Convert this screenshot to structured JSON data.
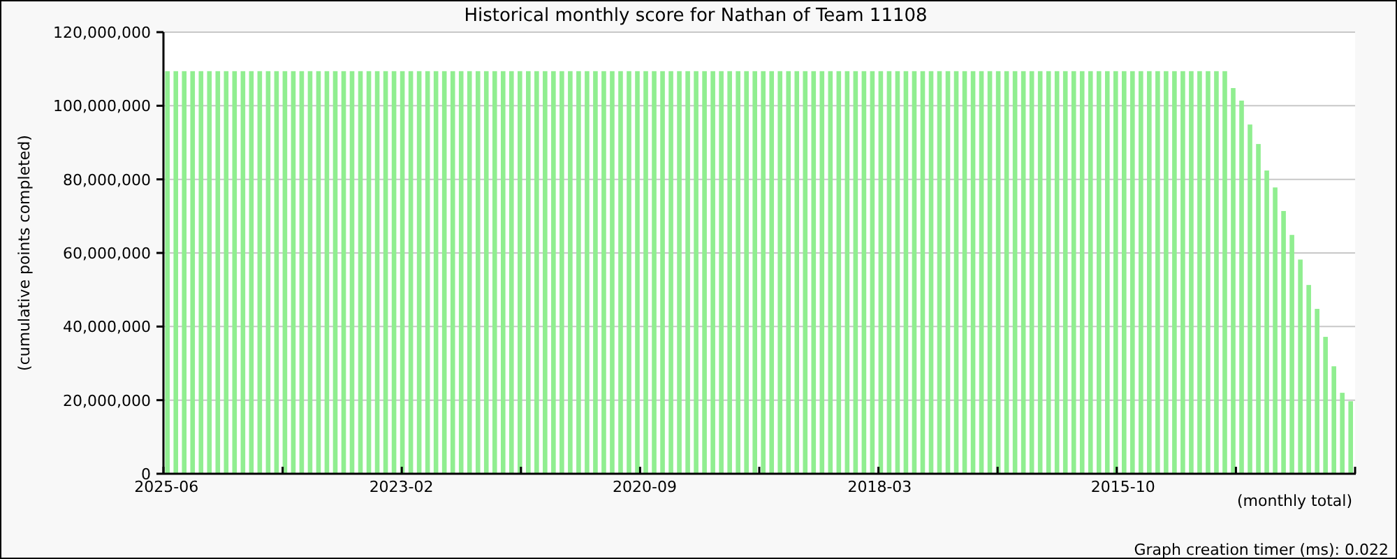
{
  "chart_data": {
    "type": "bar",
    "title": "Historical monthly score for Nathan of Team 11108",
    "xlabel": "(monthly total)",
    "ylabel": "(cumulative points completed)",
    "categories": [
      "2025-06",
      null,
      null,
      null,
      null,
      null,
      null,
      null,
      null,
      null,
      null,
      null,
      null,
      null,
      null,
      null,
      null,
      null,
      null,
      null,
      null,
      null,
      null,
      null,
      null,
      null,
      null,
      null,
      "2023-02",
      null,
      null,
      null,
      null,
      null,
      null,
      null,
      null,
      null,
      null,
      null,
      null,
      null,
      null,
      null,
      null,
      null,
      null,
      null,
      null,
      null,
      null,
      null,
      null,
      null,
      null,
      null,
      null,
      "2020-09",
      null,
      null,
      null,
      null,
      null,
      null,
      null,
      null,
      null,
      null,
      null,
      null,
      null,
      null,
      null,
      null,
      null,
      null,
      null,
      null,
      null,
      null,
      null,
      null,
      null,
      null,
      null,
      "2018-03",
      null,
      null,
      null,
      null,
      null,
      null,
      null,
      null,
      null,
      null,
      null,
      null,
      null,
      null,
      null,
      null,
      null,
      null,
      null,
      null,
      null,
      null,
      null,
      null,
      null,
      null,
      null,
      null,
      "2015-10",
      null,
      null,
      null,
      null,
      null,
      null,
      null,
      null,
      null,
      null,
      null,
      null,
      null,
      null,
      null,
      null,
      null,
      null,
      null,
      null,
      null,
      null,
      null,
      null,
      null,
      null,
      null
    ],
    "values": [
      109400000,
      109400000,
      109400000,
      109400000,
      109400000,
      109400000,
      109400000,
      109400000,
      109400000,
      109400000,
      109400000,
      109400000,
      109400000,
      109400000,
      109400000,
      109400000,
      109400000,
      109400000,
      109400000,
      109400000,
      109400000,
      109400000,
      109400000,
      109400000,
      109400000,
      109400000,
      109400000,
      109400000,
      109400000,
      109400000,
      109400000,
      109400000,
      109400000,
      109400000,
      109400000,
      109400000,
      109400000,
      109400000,
      109400000,
      109400000,
      109400000,
      109400000,
      109400000,
      109400000,
      109400000,
      109400000,
      109400000,
      109400000,
      109400000,
      109400000,
      109400000,
      109400000,
      109400000,
      109400000,
      109400000,
      109400000,
      109400000,
      109400000,
      109400000,
      109400000,
      109400000,
      109400000,
      109400000,
      109400000,
      109400000,
      109400000,
      109400000,
      109400000,
      109400000,
      109400000,
      109400000,
      109400000,
      109400000,
      109400000,
      109400000,
      109400000,
      109400000,
      109400000,
      109400000,
      109400000,
      109400000,
      109400000,
      109400000,
      109400000,
      109400000,
      109400000,
      109400000,
      109400000,
      109400000,
      109400000,
      109400000,
      109400000,
      109400000,
      109400000,
      109400000,
      109400000,
      109400000,
      109400000,
      109400000,
      109400000,
      109400000,
      109400000,
      109400000,
      109400000,
      109400000,
      109400000,
      109400000,
      109400000,
      109400000,
      109400000,
      109400000,
      109400000,
      109400000,
      109400000,
      109400000,
      109400000,
      109400000,
      109400000,
      109400000,
      109400000,
      109400000,
      109400000,
      109400000,
      109400000,
      109400000,
      109400000,
      109400000,
      104800000,
      101400000,
      94900000,
      89600000,
      82400000,
      77800000,
      71400000,
      64900000,
      58200000,
      51300000,
      44800000,
      37200000,
      29200000,
      22000000,
      19700000
    ],
    "ylim": [
      0,
      120000000
    ],
    "grid": true,
    "yticks": [
      {
        "value": 0,
        "label": "0"
      },
      {
        "value": 20000000,
        "label": "20,000,000"
      },
      {
        "value": 40000000,
        "label": "40,000,000"
      },
      {
        "value": 60000000,
        "label": "60,000,000"
      },
      {
        "value": 80000000,
        "label": "80,000,000"
      },
      {
        "value": 100000000,
        "label": "100,000,000"
      },
      {
        "value": 120000000,
        "label": "120,000,000"
      }
    ]
  },
  "timer": "Graph creation timer (ms): 0.022"
}
